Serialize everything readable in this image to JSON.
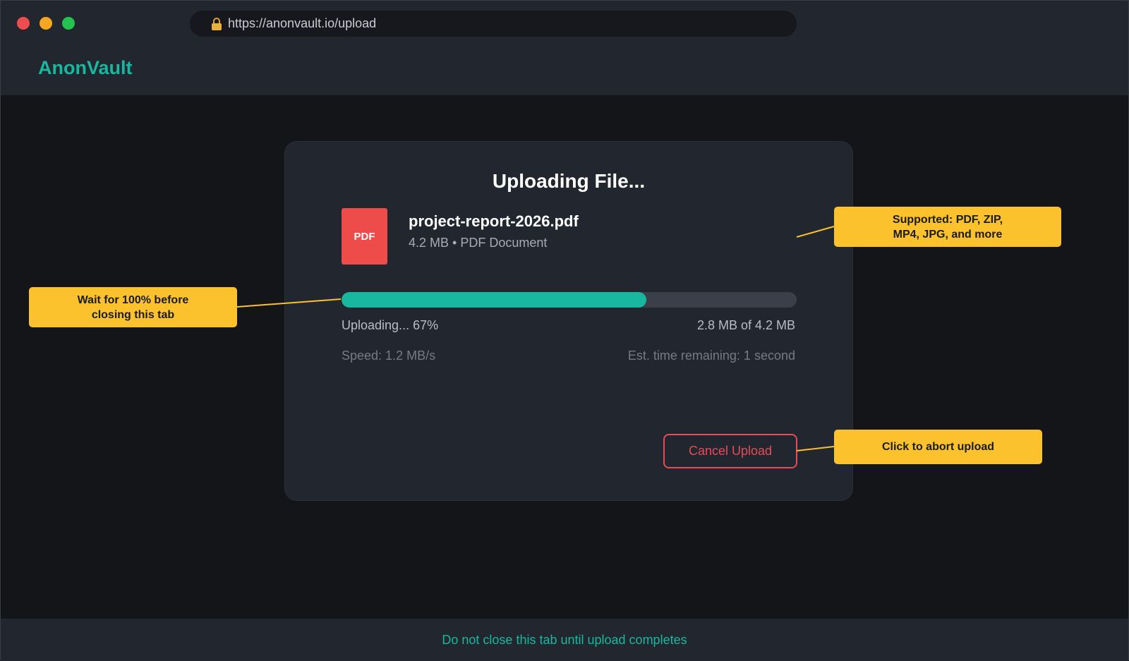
{
  "browser": {
    "url": "https://anonvault.io/upload",
    "lock_icon": "lock-icon"
  },
  "app": {
    "brand": "AnonVault"
  },
  "upload": {
    "title": "Uploading File...",
    "file_icon_label": "PDF",
    "file_name": "project-report-2026.pdf",
    "file_meta": "4.2 MB • PDF Document",
    "progress": 0.67,
    "status": "Uploading... 67%",
    "bytes": "2.8 MB of 4.2 MB",
    "speed": "Speed: 1.2 MB/s",
    "eta": "Est. time remaining: 1 second",
    "cancel_label": "Cancel Upload"
  },
  "callouts": {
    "wait_line1": "Wait for 100% before",
    "wait_line2": "closing this tab",
    "supported_line1": "Supported: PDF, ZIP,",
    "supported_line2": "MP4, JPG, and more",
    "abort": "Click to abort upload"
  },
  "footer": {
    "notice": "Do not close this tab until upload completes"
  },
  "colors": {
    "accent": "#18b8a0",
    "danger": "#e84b57",
    "callout": "#fbc22e",
    "pdf": "#ee4b4b"
  }
}
